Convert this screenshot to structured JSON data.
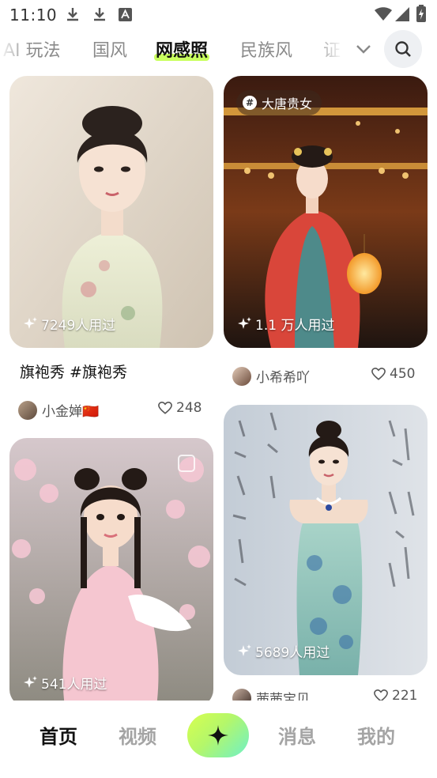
{
  "status": {
    "time": "11:10"
  },
  "tabs": [
    {
      "label": "AI 玩法"
    },
    {
      "label": "国风"
    },
    {
      "label": "网感照"
    },
    {
      "label": "民族风"
    },
    {
      "label": "证"
    }
  ],
  "cards": [
    {
      "uses": "7249人用过",
      "title": "旗袍秀 #旗袍秀",
      "author": "小金婵🇨🇳",
      "likes": "248"
    },
    {
      "topic": "大唐贵女",
      "uses": "1.1 万人用过",
      "author": "小希希吖",
      "likes": "450"
    },
    {
      "uses": "541人用过"
    },
    {
      "uses": "5689人用过",
      "author": "茜茜宝贝",
      "likes": "221"
    }
  ],
  "nav": {
    "home": "首页",
    "video": "视频",
    "messages": "消息",
    "mine": "我的"
  },
  "colors": {
    "accent_highlight": "#c9ff5f",
    "create_gradient_start": "#d8ff4f",
    "create_gradient_end": "#6ef0c8"
  }
}
